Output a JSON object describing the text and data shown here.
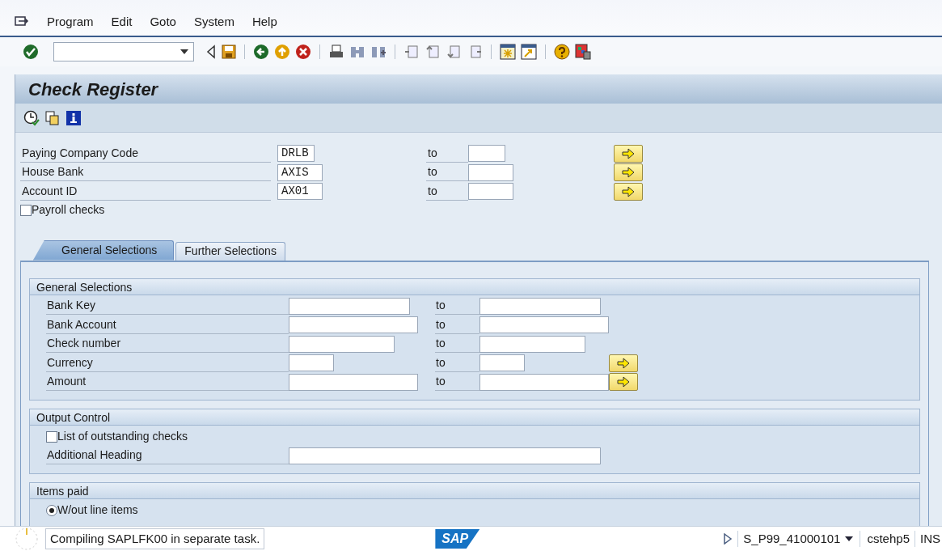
{
  "menu": [
    {
      "label": "Program"
    },
    {
      "label": "Edit"
    },
    {
      "label": "Goto"
    },
    {
      "label": "System"
    },
    {
      "label": "Help"
    }
  ],
  "title": "Check Register",
  "header_fields": [
    {
      "label": "Paying Company Code",
      "value": "DRLB",
      "to": "to"
    },
    {
      "label": "House Bank",
      "value": "AXIS",
      "to": "to"
    },
    {
      "label": "Account ID",
      "value": "AX01",
      "to": "to"
    }
  ],
  "payroll_checks": {
    "label": "Payroll checks",
    "checked": false
  },
  "tabs": [
    {
      "label": "General Selections",
      "selected": true
    },
    {
      "label": "Further Selections",
      "selected": false
    }
  ],
  "groups": [
    {
      "title": "General Selections",
      "rows": [
        {
          "kind": "range",
          "label": "Bank Key",
          "to": "to",
          "more": false
        },
        {
          "kind": "range",
          "label": "Bank Account",
          "to": "to",
          "more": false
        },
        {
          "kind": "range",
          "label": "Check number",
          "to": "to",
          "more": false
        },
        {
          "kind": "range",
          "label": "Currency",
          "to": "to",
          "more": true
        },
        {
          "kind": "range",
          "label": "Amount",
          "to": "to",
          "more": true
        }
      ]
    },
    {
      "title": "Output Control",
      "rows": [
        {
          "kind": "checkbox",
          "label": "List of outstanding checks",
          "checked": false
        },
        {
          "kind": "field",
          "label": "Additional Heading"
        }
      ]
    },
    {
      "title": "Items paid",
      "rows": [
        {
          "kind": "radio",
          "label": "W/out line items",
          "selected": true
        }
      ]
    }
  ],
  "status_bar": {
    "message": "Compiling SAPLFK00 in separate task.",
    "logo": "SAP",
    "system": "S_P99_41000101",
    "server": "cstehp5",
    "mode": "INS"
  }
}
